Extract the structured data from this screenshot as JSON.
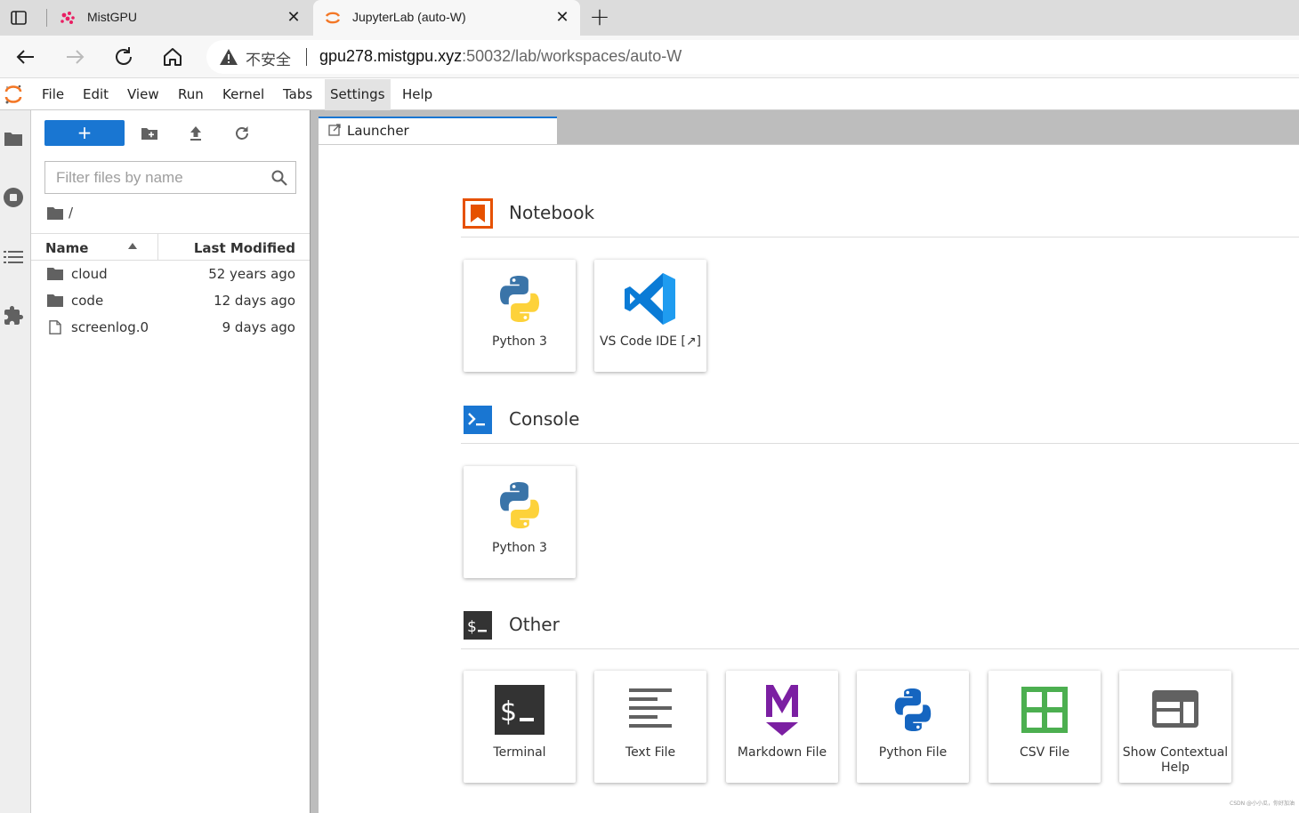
{
  "browser": {
    "tabs": [
      {
        "title": "MistGPU",
        "active": false
      },
      {
        "title": "JupyterLab (auto-W)",
        "active": true
      }
    ],
    "security_label": "不安全",
    "url_host": "gpu278.mistgpu.xyz",
    "url_rest": ":50032/lab/workspaces/auto-W"
  },
  "menubar": {
    "items": [
      "File",
      "Edit",
      "View",
      "Run",
      "Kernel",
      "Tabs",
      "Settings",
      "Help"
    ]
  },
  "filebrowser": {
    "new_button": "+",
    "filter_placeholder": "Filter files by name",
    "breadcrumb": "/",
    "columns": {
      "name": "Name",
      "modified": "Last Modified"
    },
    "rows": [
      {
        "name": "cloud",
        "type": "folder",
        "modified": "52 years ago"
      },
      {
        "name": "code",
        "type": "folder",
        "modified": "12 days ago"
      },
      {
        "name": "screenlog.0",
        "type": "file",
        "modified": "9 days ago"
      }
    ]
  },
  "document_tab": {
    "title": "Launcher"
  },
  "launcher": {
    "sections": [
      {
        "title": "Notebook",
        "cards": [
          {
            "label": "Python 3",
            "icon": "python-icon"
          },
          {
            "label": "VS Code IDE [↗]",
            "icon": "vscode-icon"
          }
        ]
      },
      {
        "title": "Console",
        "cards": [
          {
            "label": "Python 3",
            "icon": "python-icon"
          }
        ]
      },
      {
        "title": "Other",
        "cards": [
          {
            "label": "Terminal",
            "icon": "terminal-icon"
          },
          {
            "label": "Text File",
            "icon": "text-file-icon"
          },
          {
            "label": "Markdown File",
            "icon": "markdown-icon"
          },
          {
            "label": "Python File",
            "icon": "python-file-icon"
          },
          {
            "label": "CSV File",
            "icon": "csv-icon"
          },
          {
            "label": "Show Contextual Help",
            "icon": "contextual-help-icon"
          }
        ]
      }
    ]
  },
  "colors": {
    "accent": "#1976d2",
    "jupyter_orange": "#f37726",
    "notebook_orange": "#e65100",
    "markdown_purple": "#7b1fa2",
    "csv_green": "#4caf50"
  },
  "watermark": "CSDN @小小瓜，你好加油"
}
